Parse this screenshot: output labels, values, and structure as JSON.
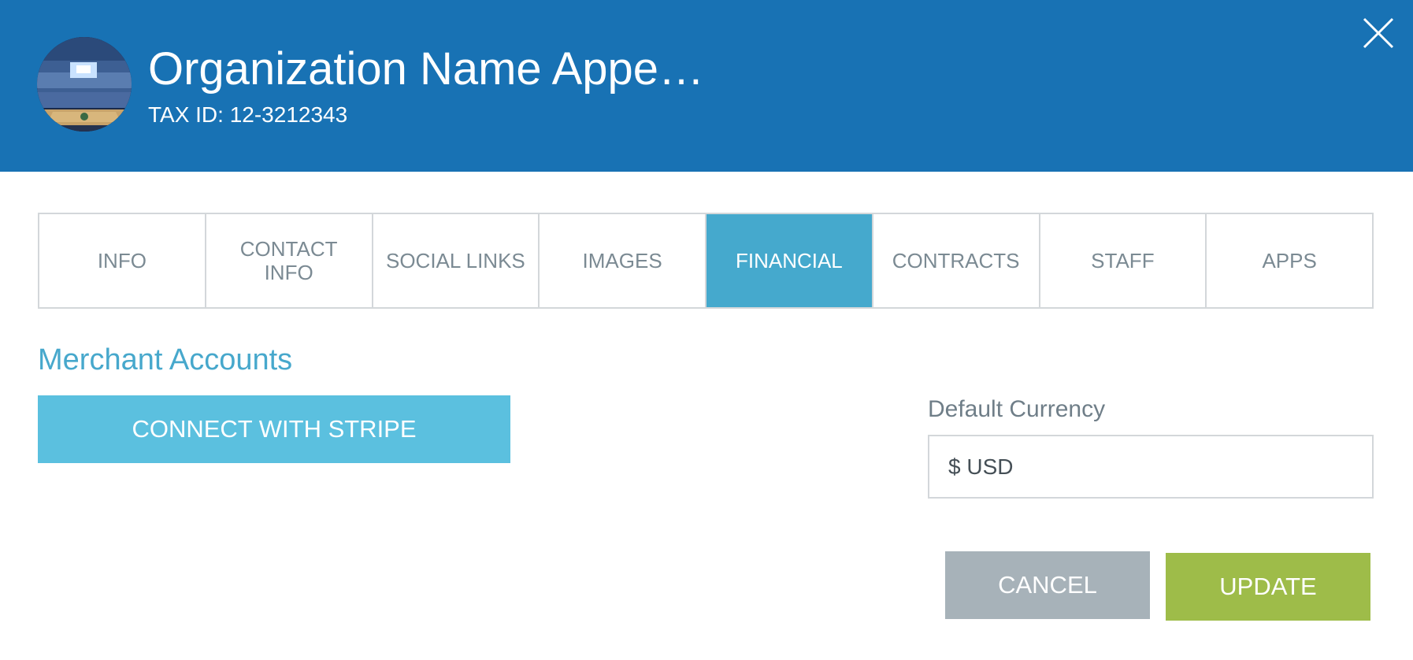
{
  "header": {
    "organization_name": "Organization Name Appe…",
    "tax_id": "TAX ID: 12-3212343",
    "background_color": "#1872b4",
    "close_icon": "close-icon",
    "avatar_icon": "arena-photo-avatar"
  },
  "tabs": [
    {
      "label": "INFO",
      "active": false
    },
    {
      "label": "CONTACT INFO",
      "active": false
    },
    {
      "label": "SOCIAL LINKS",
      "active": false
    },
    {
      "label": "IMAGES",
      "active": false
    },
    {
      "label": "FINANCIAL",
      "active": true
    },
    {
      "label": "CONTRACTS",
      "active": false
    },
    {
      "label": "STAFF",
      "active": false
    },
    {
      "label": "APPS",
      "active": false
    }
  ],
  "financial": {
    "section_title": "Merchant Accounts",
    "stripe_button_label": "CONNECT WITH STRIPE",
    "currency_label": "Default Currency",
    "currency_value": "$ USD"
  },
  "actions": {
    "cancel_label": "CANCEL",
    "update_label": "UPDATE"
  },
  "colors": {
    "active_tab": "#45a9cd",
    "stripe_button": "#5bc0df",
    "cancel_button": "#a7b2b9",
    "update_button": "#9ebc49",
    "section_title": "#47a8cc"
  }
}
